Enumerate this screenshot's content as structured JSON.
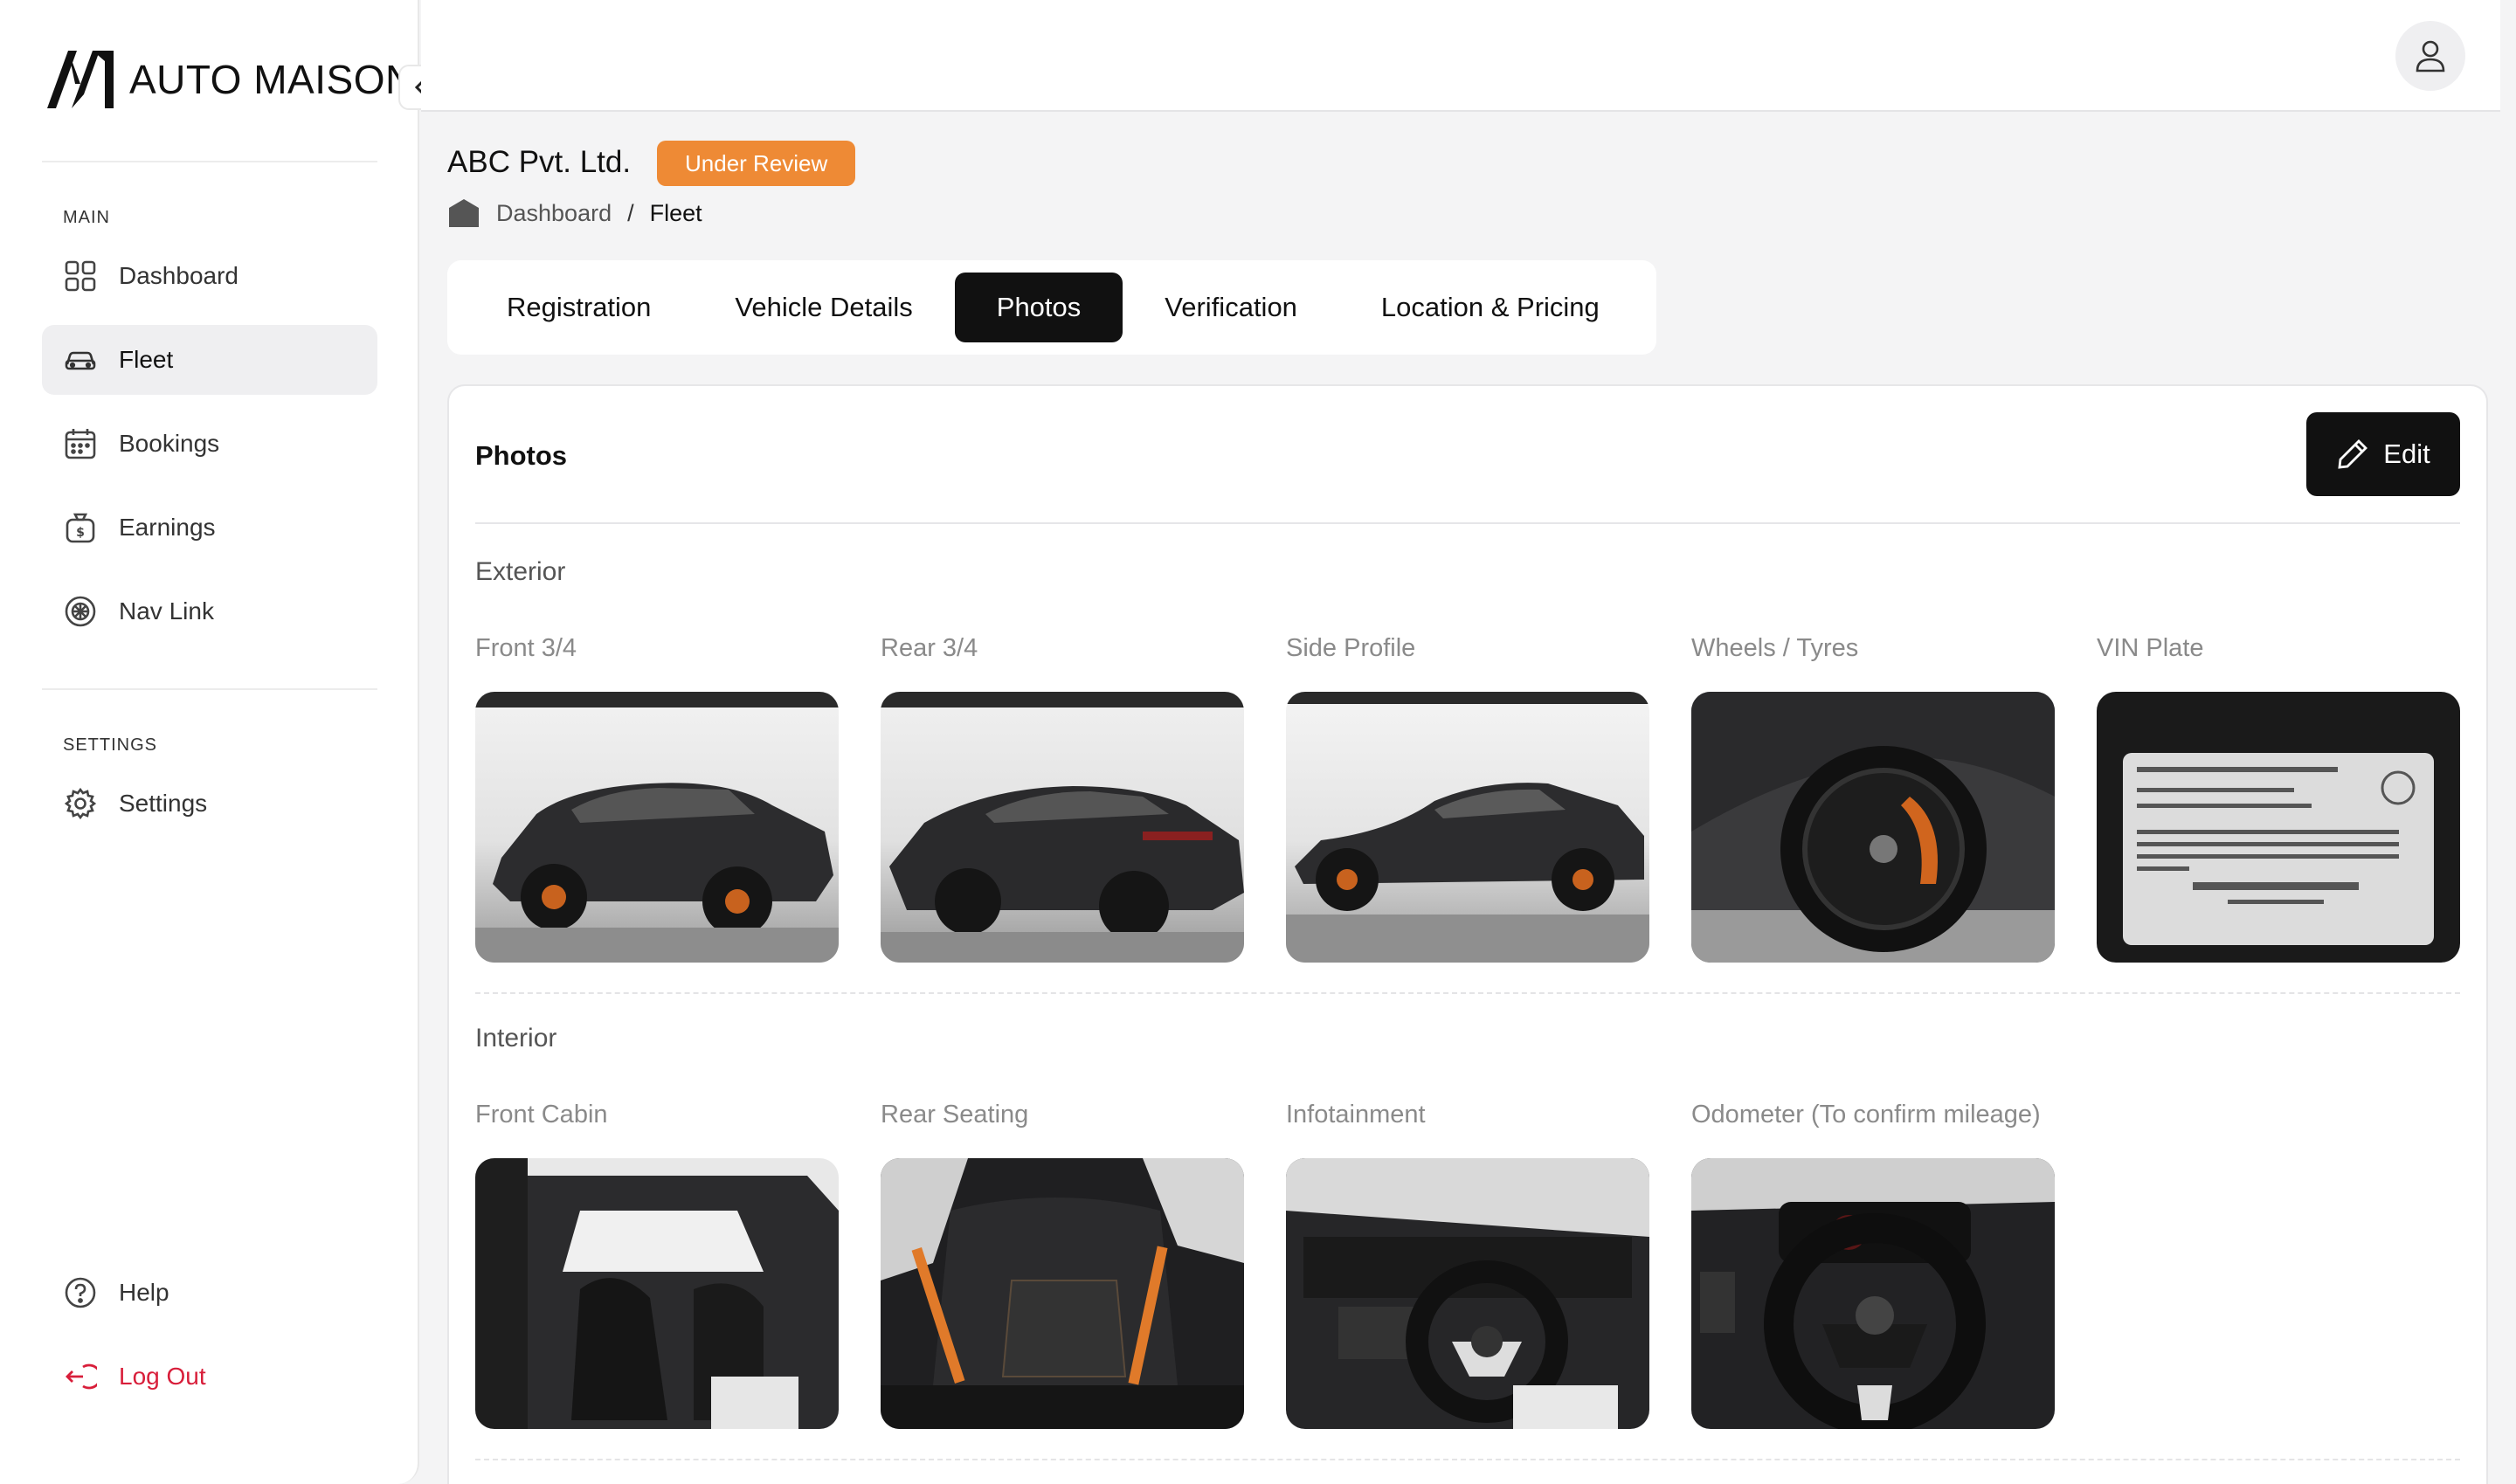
{
  "brand": {
    "name": "AUTO MAISON"
  },
  "sidebar": {
    "main_label": "MAIN",
    "items": [
      {
        "label": "Dashboard",
        "icon": "grid-icon"
      },
      {
        "label": "Fleet",
        "icon": "car-icon"
      },
      {
        "label": "Bookings",
        "icon": "calendar-icon"
      },
      {
        "label": "Earnings",
        "icon": "money-bag-icon"
      },
      {
        "label": "Nav Link",
        "icon": "target-icon"
      }
    ],
    "settings_label": "SETTINGS",
    "settings_item": {
      "label": "Settings",
      "icon": "gear-icon"
    },
    "help": {
      "label": "Help",
      "icon": "question-icon"
    },
    "logout": {
      "label": "Log Out",
      "icon": "logout-icon"
    }
  },
  "header": {
    "title": "ABC Pvt. Ltd.",
    "status": "Under Review",
    "breadcrumb": [
      "Dashboard",
      "Fleet"
    ],
    "breadcrumb_sep": "/"
  },
  "tabs": [
    "Registration",
    "Vehicle Details",
    "Photos",
    "Verification",
    "Location & Pricing"
  ],
  "active_tab": "Photos",
  "card": {
    "title": "Photos",
    "edit_label": "Edit",
    "exterior": {
      "label": "Exterior",
      "photos": [
        "Front 3/4",
        "Rear 3/4",
        "Side Profile",
        "Wheels / Tyres",
        "VIN Plate"
      ]
    },
    "interior": {
      "label": "Interior",
      "photos": [
        "Front Cabin",
        "Rear Seating",
        "Infotainment",
        "Odometer (To confirm mileage)"
      ]
    }
  },
  "colors": {
    "accent": "#ee8a35",
    "active_tab": "#111111",
    "logout": "#d81e3a"
  }
}
